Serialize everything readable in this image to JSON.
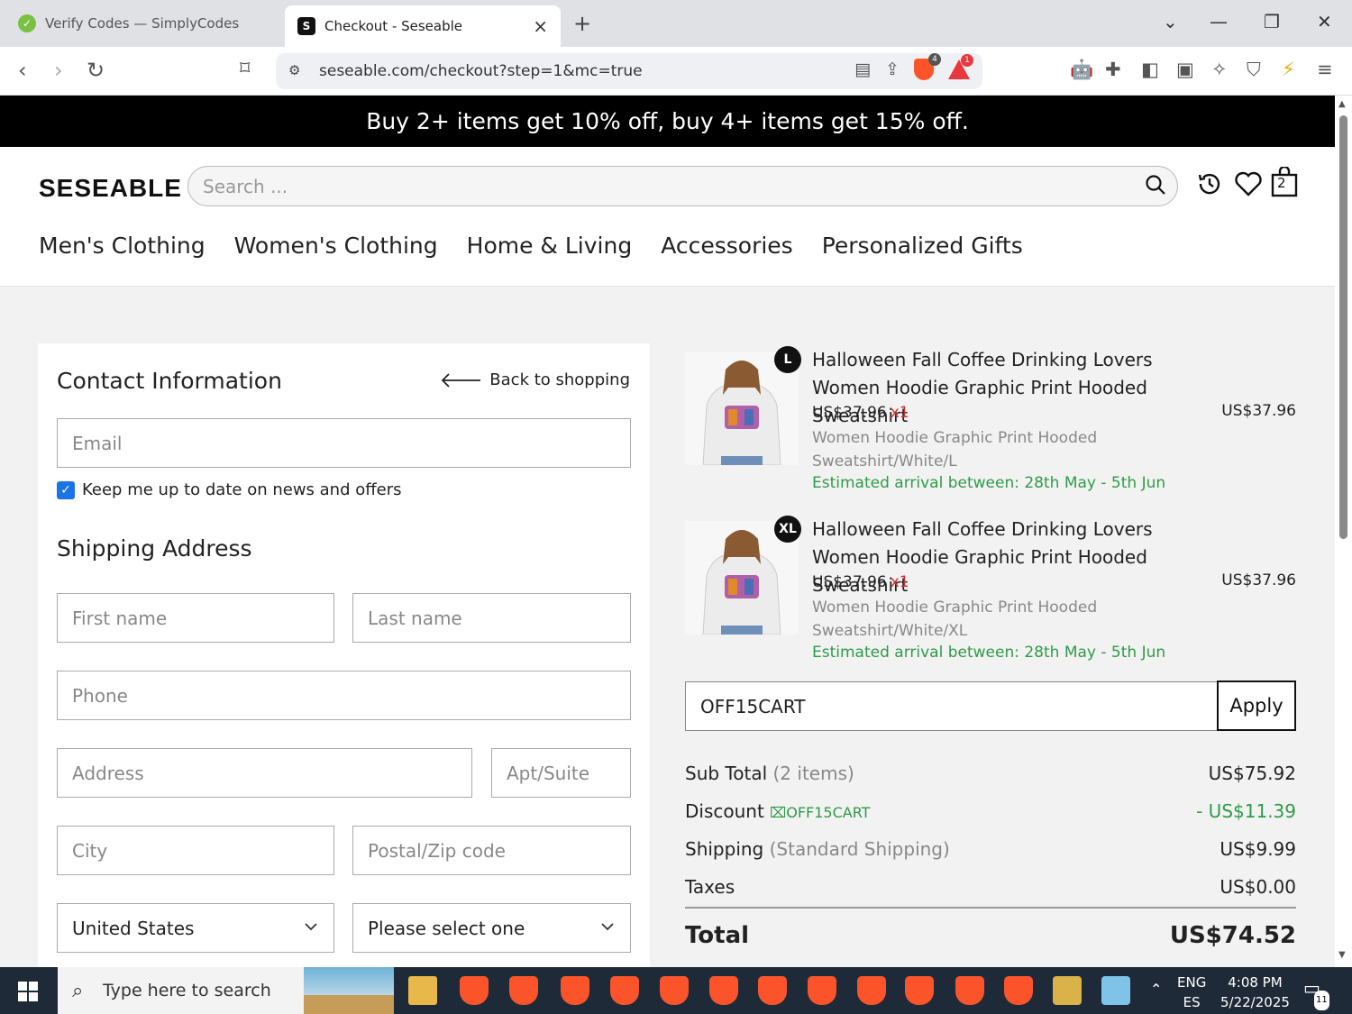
{
  "browser": {
    "tabs": [
      {
        "title": "Verify Codes — SimplyCodes",
        "active": false
      },
      {
        "title": "Checkout - Seseable",
        "active": true,
        "favicon": "S"
      }
    ],
    "url": "seseable.com/checkout?step=1&mc=true",
    "shield_badge": "4",
    "rewards_badge": "1"
  },
  "promo": "Buy 2+ items get 10% off, buy 4+ items get 15% off.",
  "header": {
    "logo": "SESEABLE",
    "search_placeholder": "Search ...",
    "cart_count": "2",
    "menu": [
      "Men's Clothing",
      "Women's Clothing",
      "Home & Living",
      "Accessories",
      "Personalized Gifts"
    ]
  },
  "contact": {
    "title": "Contact Information",
    "back": "Back to shopping",
    "email_placeholder": "Email",
    "newsletter": "Keep me up to date on news and offers"
  },
  "shipping": {
    "title": "Shipping Address",
    "first_name": "First name",
    "last_name": "Last name",
    "phone": "Phone",
    "address": "Address",
    "apt": "Apt/Suite",
    "city": "City",
    "zip": "Postal/Zip code",
    "country": "United States",
    "state": "Please select one"
  },
  "cart": {
    "items": [
      {
        "size": "L",
        "title": "Halloween Fall Coffee Drinking Lovers Women Hoodie Graphic Print Hooded Sweatshirt",
        "price": "US$37.96",
        "qty": "x1",
        "variant": "Women Hoodie Graphic Print Hooded Sweatshirt/White/L",
        "arrival": "Estimated arrival between: 28th May - 5th Jun",
        "line_total": "US$37.96"
      },
      {
        "size": "XL",
        "title": "Halloween Fall Coffee Drinking Lovers Women Hoodie Graphic Print Hooded Sweatshirt",
        "price": "US$37.96",
        "qty": "x1",
        "variant": "Women Hoodie Graphic Print Hooded Sweatshirt/White/XL",
        "arrival": "Estimated arrival between: 28th May - 5th Jun",
        "line_total": "US$37.96"
      }
    ],
    "coupon_value": "OFF15CART",
    "apply": "Apply"
  },
  "summary": {
    "subtotal_label": "Sub Total",
    "subtotal_note": "(2 items)",
    "subtotal": "US$75.92",
    "discount_label": "Discount",
    "discount_code": "OFF15CART",
    "discount": "- US$11.39",
    "shipping_label": "Shipping",
    "shipping_note": "(Standard Shipping)",
    "shipping": "US$9.99",
    "taxes_label": "Taxes",
    "taxes": "US$0.00",
    "total_label": "Total",
    "total": "US$74.52"
  },
  "taskbar": {
    "search_placeholder": "Type here to search",
    "lang_top": "ENG",
    "lang_bottom": "ES",
    "time": "4:08 PM",
    "date": "5/22/2025",
    "notif_count": "11"
  },
  "colors": {
    "accent_green": "#2e9b47",
    "price_red": "#d32f2f",
    "checkbox_blue": "#1a73e8",
    "promo_bg": "#000000",
    "brave_orange": "#fb542b"
  }
}
